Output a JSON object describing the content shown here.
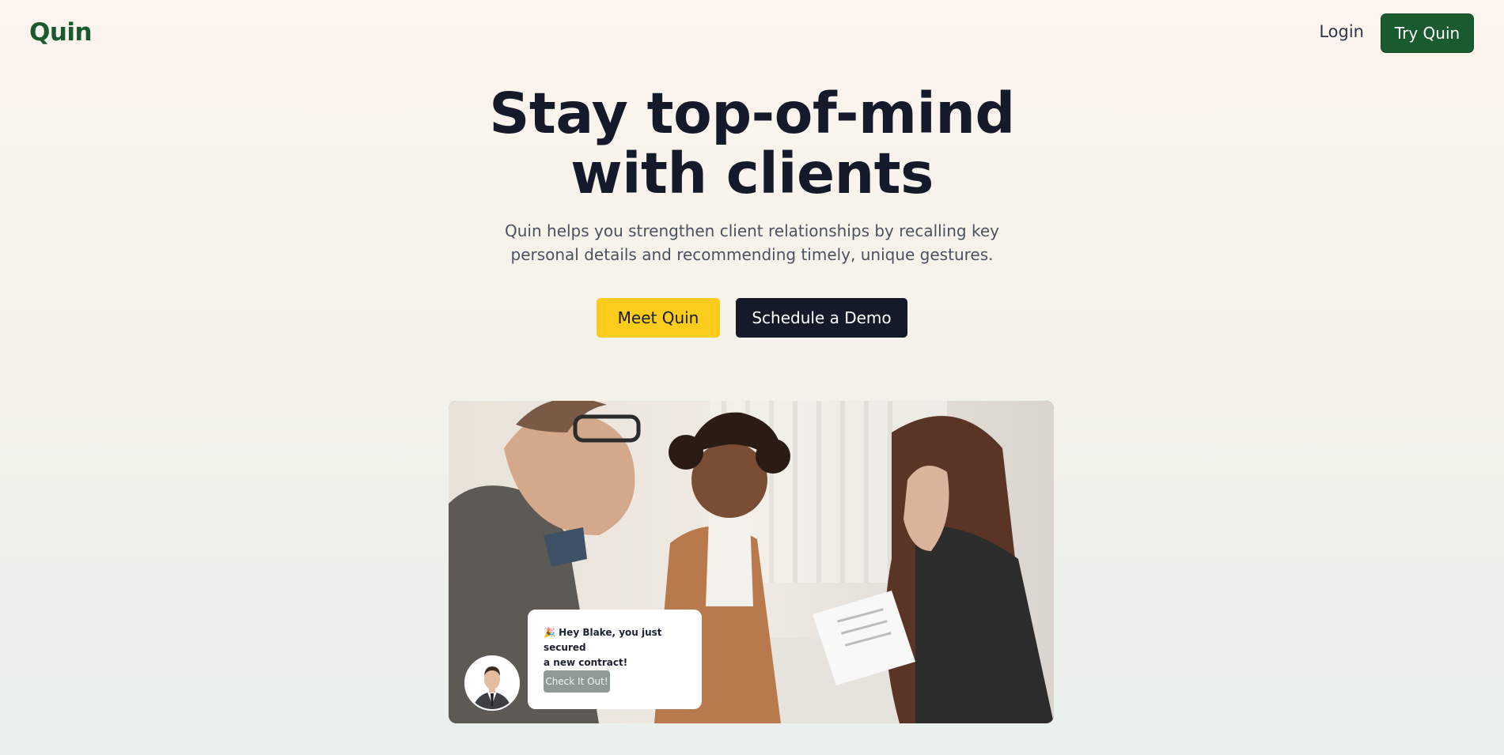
{
  "nav": {
    "logo": "Quin",
    "login_label": "Login",
    "try_label": "Try Quin"
  },
  "hero": {
    "title_line1": "Stay top-of-mind",
    "title_line2": "with clients",
    "subtitle_line1": "Quin helps you strengthen client relationships by recalling key",
    "subtitle_line2": "personal details and recommending timely, unique gestures.",
    "meet_label": "Meet Quin",
    "demo_label": "Schedule a Demo"
  },
  "notification": {
    "emoji": "🎉",
    "line1": "Hey Blake, you just secured",
    "line2": "a new contract!",
    "button_label": "Check It Out!"
  },
  "colors": {
    "brand_green": "#1a5a2f",
    "accent_yellow": "#fbcc1c",
    "dark_navy": "#151a2b"
  }
}
